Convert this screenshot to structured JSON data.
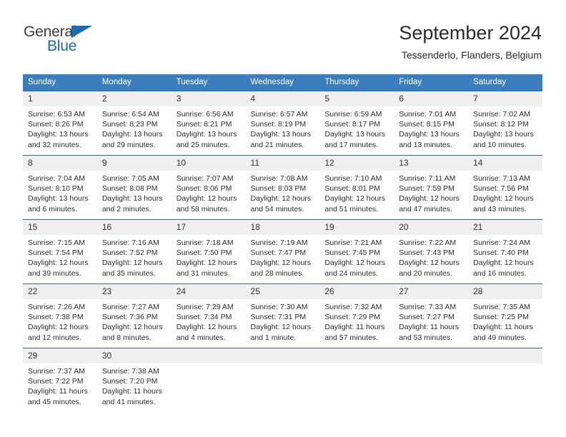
{
  "brand": {
    "name_top": "General",
    "name_bottom": "Blue",
    "triangle_icon": "triangle-icon",
    "color_blue": "#1a6bb0",
    "color_dark": "#3c3c3c"
  },
  "header": {
    "title": "September 2024",
    "subtitle": "Tessenderlo, Flanders, Belgium"
  },
  "theme": {
    "header_bg": "#3b7ebd",
    "header_text": "#ffffff",
    "daynum_bg": "#efefef",
    "row_divider": "#2c6ca8",
    "body_text": "#2c2c2c"
  },
  "weekdays": [
    "Sunday",
    "Monday",
    "Tuesday",
    "Wednesday",
    "Thursday",
    "Friday",
    "Saturday"
  ],
  "weeks": [
    [
      {
        "day": "1",
        "sunrise": "Sunrise: 6:53 AM",
        "sunset": "Sunset: 8:26 PM",
        "daylight1": "Daylight: 13 hours",
        "daylight2": "and 32 minutes."
      },
      {
        "day": "2",
        "sunrise": "Sunrise: 6:54 AM",
        "sunset": "Sunset: 8:23 PM",
        "daylight1": "Daylight: 13 hours",
        "daylight2": "and 29 minutes."
      },
      {
        "day": "3",
        "sunrise": "Sunrise: 6:56 AM",
        "sunset": "Sunset: 8:21 PM",
        "daylight1": "Daylight: 13 hours",
        "daylight2": "and 25 minutes."
      },
      {
        "day": "4",
        "sunrise": "Sunrise: 6:57 AM",
        "sunset": "Sunset: 8:19 PM",
        "daylight1": "Daylight: 13 hours",
        "daylight2": "and 21 minutes."
      },
      {
        "day": "5",
        "sunrise": "Sunrise: 6:59 AM",
        "sunset": "Sunset: 8:17 PM",
        "daylight1": "Daylight: 13 hours",
        "daylight2": "and 17 minutes."
      },
      {
        "day": "6",
        "sunrise": "Sunrise: 7:01 AM",
        "sunset": "Sunset: 8:15 PM",
        "daylight1": "Daylight: 13 hours",
        "daylight2": "and 13 minutes."
      },
      {
        "day": "7",
        "sunrise": "Sunrise: 7:02 AM",
        "sunset": "Sunset: 8:12 PM",
        "daylight1": "Daylight: 13 hours",
        "daylight2": "and 10 minutes."
      }
    ],
    [
      {
        "day": "8",
        "sunrise": "Sunrise: 7:04 AM",
        "sunset": "Sunset: 8:10 PM",
        "daylight1": "Daylight: 13 hours",
        "daylight2": "and 6 minutes."
      },
      {
        "day": "9",
        "sunrise": "Sunrise: 7:05 AM",
        "sunset": "Sunset: 8:08 PM",
        "daylight1": "Daylight: 13 hours",
        "daylight2": "and 2 minutes."
      },
      {
        "day": "10",
        "sunrise": "Sunrise: 7:07 AM",
        "sunset": "Sunset: 8:06 PM",
        "daylight1": "Daylight: 12 hours",
        "daylight2": "and 58 minutes."
      },
      {
        "day": "11",
        "sunrise": "Sunrise: 7:08 AM",
        "sunset": "Sunset: 8:03 PM",
        "daylight1": "Daylight: 12 hours",
        "daylight2": "and 54 minutes."
      },
      {
        "day": "12",
        "sunrise": "Sunrise: 7:10 AM",
        "sunset": "Sunset: 8:01 PM",
        "daylight1": "Daylight: 12 hours",
        "daylight2": "and 51 minutes."
      },
      {
        "day": "13",
        "sunrise": "Sunrise: 7:11 AM",
        "sunset": "Sunset: 7:59 PM",
        "daylight1": "Daylight: 12 hours",
        "daylight2": "and 47 minutes."
      },
      {
        "day": "14",
        "sunrise": "Sunrise: 7:13 AM",
        "sunset": "Sunset: 7:56 PM",
        "daylight1": "Daylight: 12 hours",
        "daylight2": "and 43 minutes."
      }
    ],
    [
      {
        "day": "15",
        "sunrise": "Sunrise: 7:15 AM",
        "sunset": "Sunset: 7:54 PM",
        "daylight1": "Daylight: 12 hours",
        "daylight2": "and 39 minutes."
      },
      {
        "day": "16",
        "sunrise": "Sunrise: 7:16 AM",
        "sunset": "Sunset: 7:52 PM",
        "daylight1": "Daylight: 12 hours",
        "daylight2": "and 35 minutes."
      },
      {
        "day": "17",
        "sunrise": "Sunrise: 7:18 AM",
        "sunset": "Sunset: 7:50 PM",
        "daylight1": "Daylight: 12 hours",
        "daylight2": "and 31 minutes."
      },
      {
        "day": "18",
        "sunrise": "Sunrise: 7:19 AM",
        "sunset": "Sunset: 7:47 PM",
        "daylight1": "Daylight: 12 hours",
        "daylight2": "and 28 minutes."
      },
      {
        "day": "19",
        "sunrise": "Sunrise: 7:21 AM",
        "sunset": "Sunset: 7:45 PM",
        "daylight1": "Daylight: 12 hours",
        "daylight2": "and 24 minutes."
      },
      {
        "day": "20",
        "sunrise": "Sunrise: 7:22 AM",
        "sunset": "Sunset: 7:43 PM",
        "daylight1": "Daylight: 12 hours",
        "daylight2": "and 20 minutes."
      },
      {
        "day": "21",
        "sunrise": "Sunrise: 7:24 AM",
        "sunset": "Sunset: 7:40 PM",
        "daylight1": "Daylight: 12 hours",
        "daylight2": "and 16 minutes."
      }
    ],
    [
      {
        "day": "22",
        "sunrise": "Sunrise: 7:26 AM",
        "sunset": "Sunset: 7:38 PM",
        "daylight1": "Daylight: 12 hours",
        "daylight2": "and 12 minutes."
      },
      {
        "day": "23",
        "sunrise": "Sunrise: 7:27 AM",
        "sunset": "Sunset: 7:36 PM",
        "daylight1": "Daylight: 12 hours",
        "daylight2": "and 8 minutes."
      },
      {
        "day": "24",
        "sunrise": "Sunrise: 7:29 AM",
        "sunset": "Sunset: 7:34 PM",
        "daylight1": "Daylight: 12 hours",
        "daylight2": "and 4 minutes."
      },
      {
        "day": "25",
        "sunrise": "Sunrise: 7:30 AM",
        "sunset": "Sunset: 7:31 PM",
        "daylight1": "Daylight: 12 hours",
        "daylight2": "and 1 minute."
      },
      {
        "day": "26",
        "sunrise": "Sunrise: 7:32 AM",
        "sunset": "Sunset: 7:29 PM",
        "daylight1": "Daylight: 11 hours",
        "daylight2": "and 57 minutes."
      },
      {
        "day": "27",
        "sunrise": "Sunrise: 7:33 AM",
        "sunset": "Sunset: 7:27 PM",
        "daylight1": "Daylight: 11 hours",
        "daylight2": "and 53 minutes."
      },
      {
        "day": "28",
        "sunrise": "Sunrise: 7:35 AM",
        "sunset": "Sunset: 7:25 PM",
        "daylight1": "Daylight: 11 hours",
        "daylight2": "and 49 minutes."
      }
    ],
    [
      {
        "day": "29",
        "sunrise": "Sunrise: 7:37 AM",
        "sunset": "Sunset: 7:22 PM",
        "daylight1": "Daylight: 11 hours",
        "daylight2": "and 45 minutes."
      },
      {
        "day": "30",
        "sunrise": "Sunrise: 7:38 AM",
        "sunset": "Sunset: 7:20 PM",
        "daylight1": "Daylight: 11 hours",
        "daylight2": "and 41 minutes."
      },
      {
        "day": "",
        "sunrise": "",
        "sunset": "",
        "daylight1": "",
        "daylight2": ""
      },
      {
        "day": "",
        "sunrise": "",
        "sunset": "",
        "daylight1": "",
        "daylight2": ""
      },
      {
        "day": "",
        "sunrise": "",
        "sunset": "",
        "daylight1": "",
        "daylight2": ""
      },
      {
        "day": "",
        "sunrise": "",
        "sunset": "",
        "daylight1": "",
        "daylight2": ""
      },
      {
        "day": "",
        "sunrise": "",
        "sunset": "",
        "daylight1": "",
        "daylight2": ""
      }
    ]
  ]
}
